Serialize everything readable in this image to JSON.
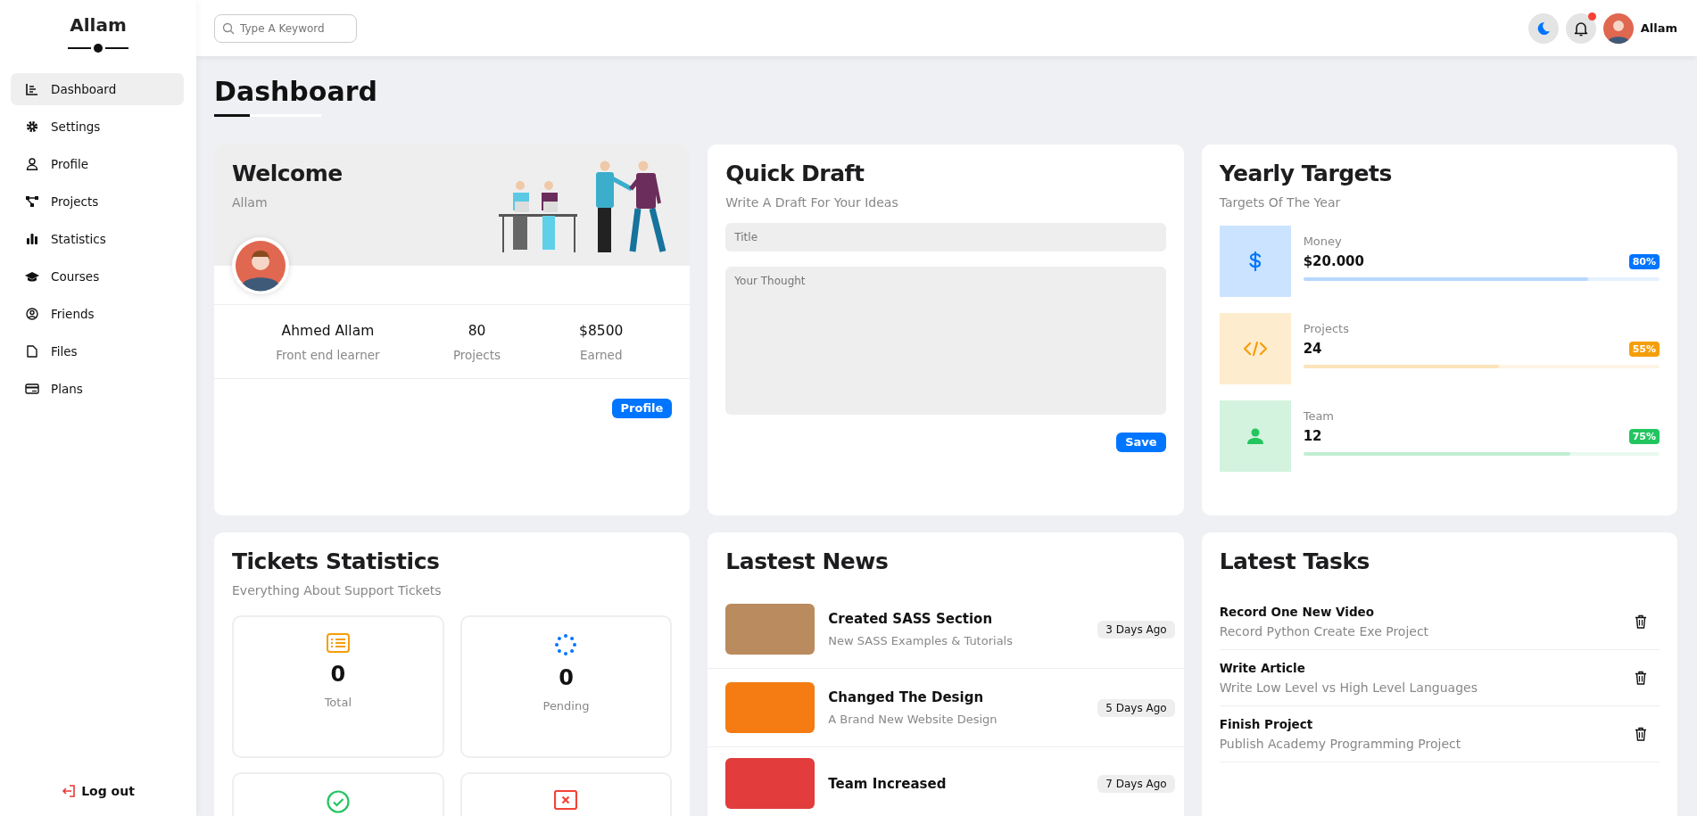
{
  "sidebar": {
    "brand": "Allam",
    "items": [
      {
        "label": "Dashboard",
        "kind": "dashboard",
        "selected": true
      },
      {
        "label": "Settings",
        "kind": "settings",
        "selected": false
      },
      {
        "label": "Profile",
        "kind": "profile",
        "selected": false
      },
      {
        "label": "Projects",
        "kind": "projects",
        "selected": false
      },
      {
        "label": "Statistics",
        "kind": "statistics",
        "selected": false
      },
      {
        "label": "Courses",
        "kind": "courses",
        "selected": false
      },
      {
        "label": "Friends",
        "kind": "friends",
        "selected": false
      },
      {
        "label": "Files",
        "kind": "files",
        "selected": false
      },
      {
        "label": "Plans",
        "kind": "plans",
        "selected": false
      }
    ],
    "logout": "Log out"
  },
  "topbar": {
    "search": {
      "placeholder": "Type A Keyword"
    },
    "notification": true,
    "user": "Allam"
  },
  "page_title": "Dashboard",
  "welcome": {
    "title": "Welcome",
    "subtitle": "Allam",
    "stats": [
      {
        "value": "Ahmed Allam",
        "label": "Front end learner"
      },
      {
        "value": "80",
        "label": "Projects"
      },
      {
        "value": "$8500",
        "label": "Earned"
      }
    ],
    "button": "Profile"
  },
  "quick_draft": {
    "title": "Quick Draft",
    "subtitle": "Write A Draft For Your Ideas",
    "title_field": {
      "placeholder": "Title"
    },
    "body_field": {
      "placeholder": "Your Thought"
    },
    "button": "Save"
  },
  "yearly_targets": {
    "title": "Yearly Targets",
    "subtitle": "Targets Of The Year",
    "targets": [
      {
        "kind": "money",
        "label": "Money",
        "value": "$20.000",
        "badge": "80%",
        "level": 0.8,
        "color": "#0075ff"
      },
      {
        "kind": "code",
        "label": "Projects",
        "value": "24",
        "badge": "55%",
        "level": 0.55,
        "color": "#f59e0b"
      },
      {
        "kind": "team",
        "label": "Team",
        "value": "12",
        "badge": "75%",
        "level": 0.75,
        "color": "#22c55e"
      }
    ]
  },
  "tickets": {
    "title": "Tickets Statistics",
    "subtitle": "Everything About Support Tickets",
    "items": [
      {
        "kind": "total",
        "value": "0",
        "label": "Total"
      },
      {
        "kind": "pending",
        "value": "0",
        "label": "Pending"
      },
      {
        "kind": "closed"
      },
      {
        "kind": "deleted"
      }
    ]
  },
  "news": {
    "title": "Lastest News",
    "items": [
      {
        "title": "Created SASS Section",
        "text": "New SASS Examples & Tutorials",
        "date": "3 Days Ago"
      },
      {
        "title": "Changed The Design",
        "text": "A Brand New Website Design",
        "date": "5 Days Ago"
      },
      {
        "title": "Team Increased",
        "date": "7 Days Ago"
      }
    ]
  },
  "tasks": {
    "title": "Latest Tasks",
    "items": [
      {
        "title": "Record One New Video",
        "text": "Record Python Create Exe Project"
      },
      {
        "title": "Write Article",
        "text": "Write Low Level vs High Level Languages"
      },
      {
        "title": "Finish Project",
        "text": "Publish Academy Programming Project"
      }
    ]
  }
}
